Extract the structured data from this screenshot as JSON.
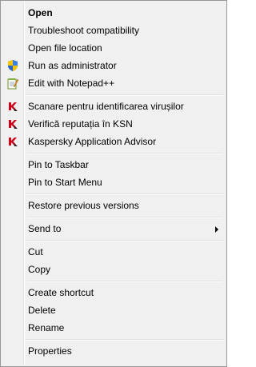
{
  "menu": {
    "open": "Open",
    "troubleshoot": "Troubleshoot compatibility",
    "open_location": "Open file location",
    "run_admin": "Run as administrator",
    "edit_notepad": "Edit with Notepad++",
    "scan": "Scanare pentru identificarea virușilor",
    "reputation": "Verifică reputația în KSN",
    "advisor": "Kaspersky Application Advisor",
    "pin_taskbar": "Pin to Taskbar",
    "pin_start": "Pin to Start Menu",
    "restore": "Restore previous versions",
    "send_to": "Send to",
    "cut": "Cut",
    "copy": "Copy",
    "create_shortcut": "Create shortcut",
    "delete": "Delete",
    "rename": "Rename",
    "properties": "Properties"
  },
  "icons": {
    "run_admin": "uac-shield-icon",
    "edit_notepad": "notepad-plus-plus-icon",
    "kaspersky": "kaspersky-k-icon"
  },
  "colors": {
    "menu_bg": "#f0f0f0",
    "kaspersky_red": "#d0021b"
  }
}
